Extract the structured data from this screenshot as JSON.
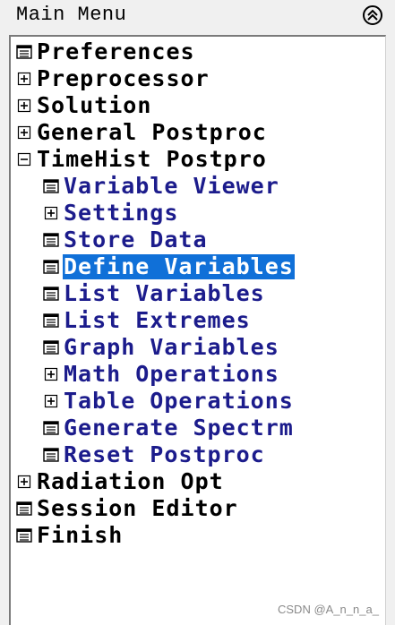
{
  "window": {
    "title": "Main Menu",
    "collapse_icon": "double-chevron-up-icon"
  },
  "tree": [
    {
      "label": "Preferences",
      "icon": "dialog-icon",
      "level": 0
    },
    {
      "label": "Preprocessor",
      "icon": "expand-plus-icon",
      "level": 0
    },
    {
      "label": "Solution",
      "icon": "expand-plus-icon",
      "level": 0
    },
    {
      "label": "General Postproc",
      "icon": "expand-plus-icon",
      "level": 0
    },
    {
      "label": "TimeHist Postpro",
      "icon": "collapse-minus-icon",
      "level": 0
    },
    {
      "label": "Variable Viewer",
      "icon": "dialog-icon",
      "level": 1
    },
    {
      "label": "Settings",
      "icon": "expand-plus-icon",
      "level": 1
    },
    {
      "label": "Store Data",
      "icon": "dialog-icon",
      "level": 1
    },
    {
      "label": "Define Variables",
      "icon": "dialog-icon",
      "level": 1,
      "selected": true
    },
    {
      "label": "List Variables",
      "icon": "dialog-icon",
      "level": 1
    },
    {
      "label": "List Extremes",
      "icon": "dialog-icon",
      "level": 1
    },
    {
      "label": "Graph Variables",
      "icon": "dialog-icon",
      "level": 1
    },
    {
      "label": "Math Operations",
      "icon": "expand-plus-icon",
      "level": 1
    },
    {
      "label": "Table Operations",
      "icon": "expand-plus-icon",
      "level": 1
    },
    {
      "label": "Generate Spectrm",
      "icon": "dialog-icon",
      "level": 1
    },
    {
      "label": "Reset Postproc",
      "icon": "dialog-icon",
      "level": 1
    },
    {
      "label": "Radiation Opt",
      "icon": "expand-plus-icon",
      "level": 0
    },
    {
      "label": "Session Editor",
      "icon": "dialog-icon",
      "level": 0
    },
    {
      "label": "Finish",
      "icon": "dialog-icon",
      "level": 0
    }
  ],
  "colors": {
    "child_text": "#1c1c8c",
    "selection": "#1070d8",
    "background": "#f0f0f0"
  },
  "watermark": "CSDN @A_n_n_a_"
}
